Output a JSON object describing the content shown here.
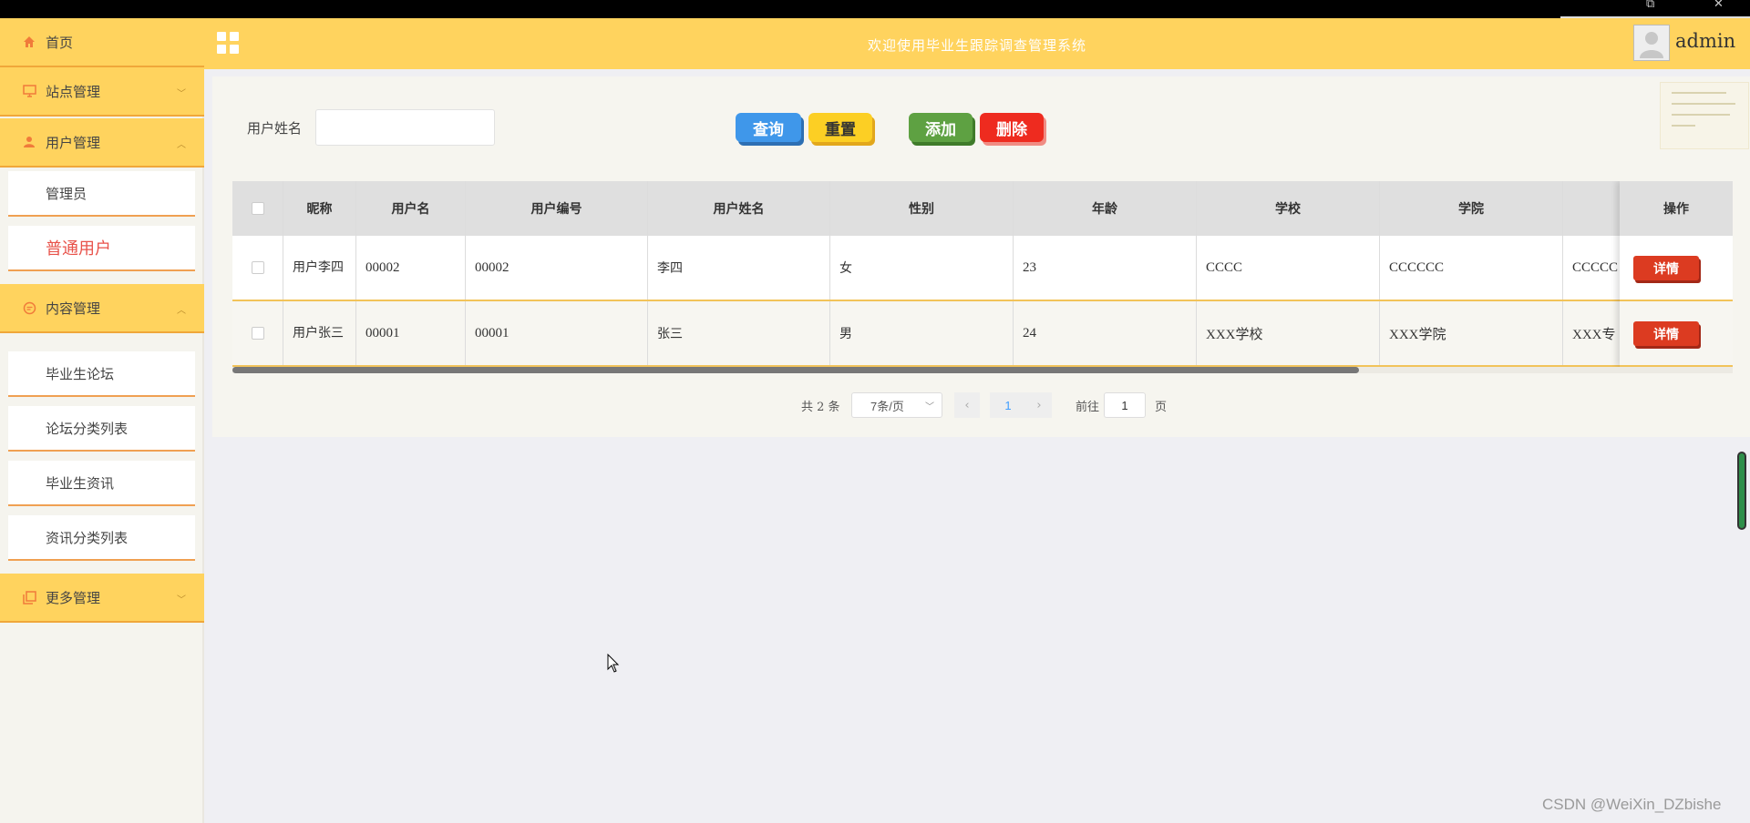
{
  "header": {
    "title": "欢迎使用毕业生跟踪调查管理系统",
    "username": "admin"
  },
  "sidebar": {
    "items": [
      {
        "label": "首页",
        "icon": "home-icon"
      },
      {
        "label": "站点管理",
        "icon": "monitor-icon"
      },
      {
        "label": "用户管理",
        "icon": "user-icon",
        "expanded": true,
        "children": [
          "管理员",
          "普通用户"
        ]
      },
      {
        "label": "内容管理",
        "icon": "chat-icon",
        "expanded": true,
        "children": [
          "毕业生论坛",
          "论坛分类列表",
          "毕业生资讯",
          "资讯分类列表"
        ]
      },
      {
        "label": "更多管理",
        "icon": "copy-icon"
      }
    ],
    "active_child": "普通用户"
  },
  "search": {
    "label": "用户姓名",
    "value": "",
    "placeholder": ""
  },
  "buttons": {
    "query": "查询",
    "reset": "重置",
    "add": "添加",
    "delete": "删除"
  },
  "table": {
    "columns": [
      "昵称",
      "用户名",
      "用户编号",
      "用户姓名",
      "性别",
      "年龄",
      "学校",
      "学院",
      "",
      "操作"
    ],
    "rows": [
      {
        "nickname": "用户李四",
        "username": "00002",
        "user_no": "00002",
        "real_name": "李四",
        "gender": "女",
        "age": "23",
        "school": "CCCC",
        "college": "CCCCCC",
        "major": "CCCCC",
        "action": "详情"
      },
      {
        "nickname": "用户张三",
        "username": "00001",
        "user_no": "00001",
        "real_name": "张三",
        "gender": "男",
        "age": "24",
        "school": "XXX学校",
        "college": "XXX学院",
        "major": "XXX专",
        "action": "详情"
      }
    ]
  },
  "pagination": {
    "total": "共 2 条",
    "page_size": "7条/页",
    "current_page": "1",
    "goto_label": "前往",
    "goto_value": "1",
    "page_suffix": "页"
  },
  "watermark": "CSDN @WeiXin_DZbishe",
  "colors": {
    "header_bg": "#ffd35e",
    "menu_border": "#f0a73a",
    "active_text": "#e8524a",
    "query_btn": "#3f97ea",
    "reset_btn": "#fccf24",
    "add_btn": "#5ea142",
    "delete_btn": "#ee2b1f",
    "detail_btn": "#dc3b21"
  }
}
